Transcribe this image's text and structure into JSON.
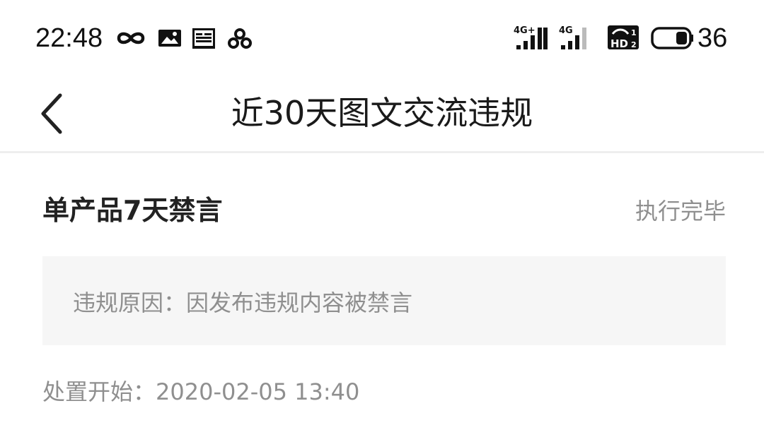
{
  "status_bar": {
    "time": "22:48",
    "battery_level": "36",
    "notification_icons": [
      "infinity-icon",
      "image-message-icon",
      "toutiao-icon",
      "pinwheel-icon"
    ],
    "right_icons": [
      "signal-4g-plus-icon",
      "signal-4g-icon",
      "hd-volte-icon",
      "battery-icon"
    ],
    "network_labels": {
      "sim1": "4G+",
      "sim2": "4G",
      "hd": "HD"
    }
  },
  "header": {
    "back_icon": "chevron-left-icon",
    "title": "近30天图文交流违规"
  },
  "record": {
    "title": "单产品7天禁言",
    "status": "执行完毕",
    "reason_text": "违规原因：因发布违规内容被禁言",
    "start_text": "处置开始：2020-02-05 13:40"
  }
}
